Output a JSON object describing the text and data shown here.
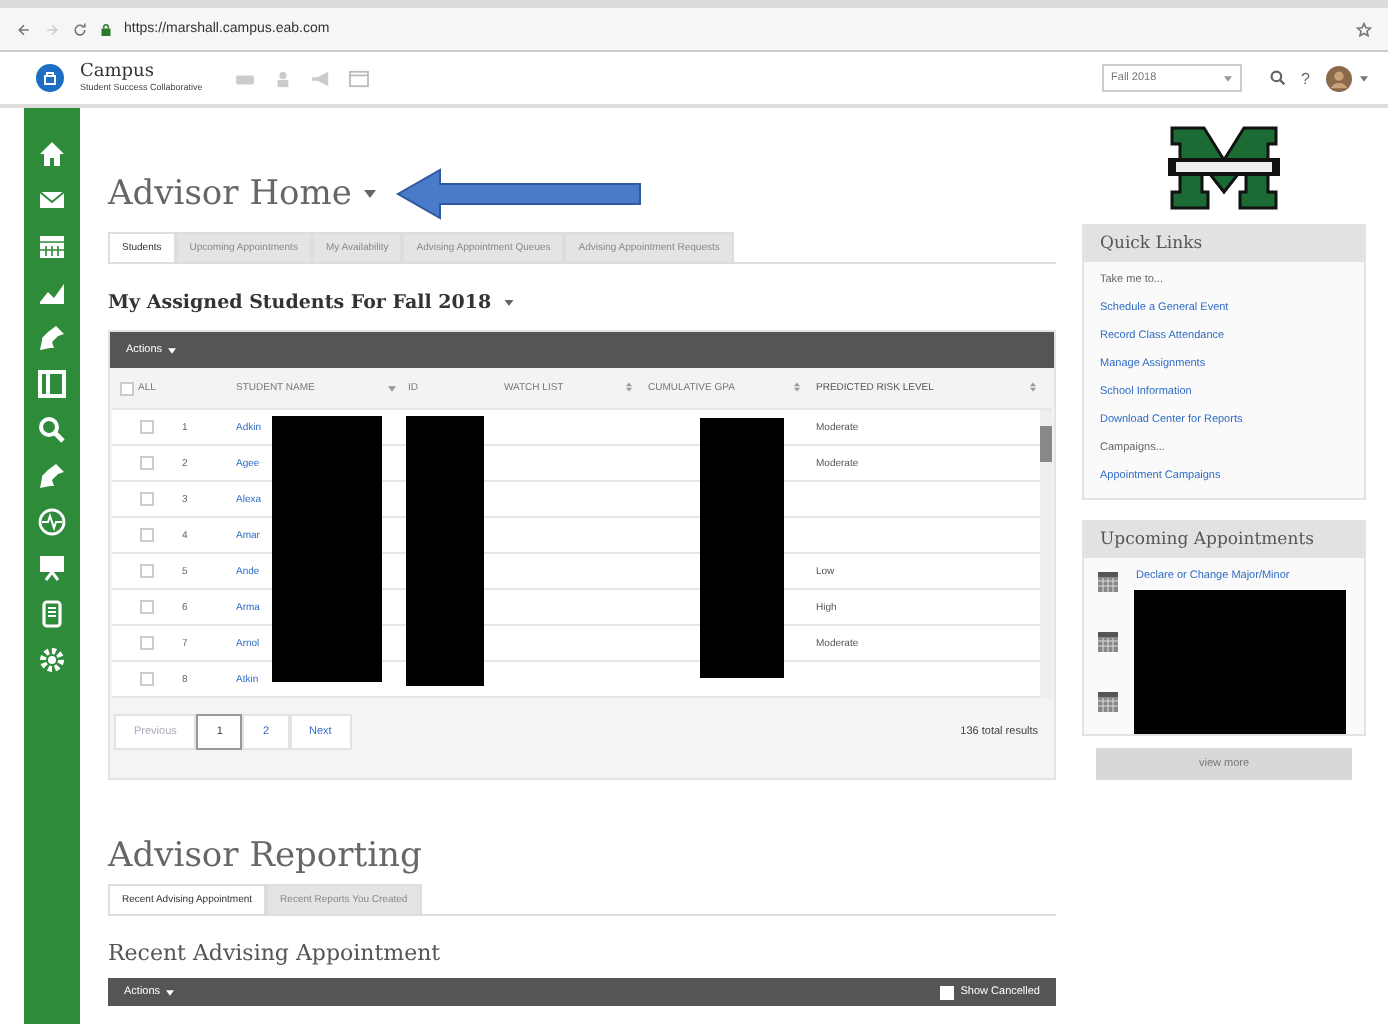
{
  "browser": {
    "url": "https://marshall.campus.eab.com"
  },
  "app_header": {
    "brand": "Campus",
    "tagline": "Student Success Collaborative",
    "term": "Fall 2018",
    "help": "?"
  },
  "page_title": "Advisor Home",
  "tabs": [
    {
      "label": "Students",
      "selected": true
    },
    {
      "label": "Upcoming Appointments",
      "selected": false
    },
    {
      "label": "My Availability",
      "selected": false
    },
    {
      "label": "Advising Appointment Queues",
      "selected": false
    },
    {
      "label": "Advising Appointment Requests",
      "selected": false
    }
  ],
  "section_title": "My Assigned Students For Fall 2018",
  "table": {
    "actions": "Actions",
    "all_checked": false,
    "columns": [
      "ALL",
      "STUDENT NAME",
      "ID",
      "WATCH LIST",
      "CUMULATIVE GPA",
      "PREDICTED RISK LEVEL"
    ],
    "rows": [
      {
        "number": "1",
        "name": "Adkin",
        "risk": "Moderate",
        "checked": false
      },
      {
        "number": "2",
        "name": "Agee",
        "risk": "Moderate",
        "checked": false
      },
      {
        "number": "3",
        "name": "Alexa",
        "checked": false
      },
      {
        "number": "4",
        "name": "Amar",
        "checked": false
      },
      {
        "number": "5",
        "name": "Ande",
        "risk": "Low",
        "checked": false
      },
      {
        "number": "6",
        "name": "Arma",
        "risk": "High",
        "checked": false
      },
      {
        "number": "7",
        "name": "Arnol",
        "risk": "Moderate",
        "checked": false
      },
      {
        "number": "8",
        "name": "Atkin",
        "checked": false
      }
    ]
  },
  "pagination": {
    "pages": [
      {
        "label": "Previous",
        "selected": false,
        "disabled": true
      },
      {
        "label": "1",
        "selected": true,
        "disabled": false
      },
      {
        "label": "2",
        "selected": false,
        "disabled": false
      },
      {
        "label": "Next",
        "selected": false,
        "disabled": false
      }
    ],
    "total": "136 total results"
  },
  "quick_links": {
    "title": "Quick Links",
    "items": [
      {
        "kind": "heading",
        "text": "Take me to..."
      },
      {
        "kind": "link",
        "text": "Schedule a General Event"
      },
      {
        "kind": "link",
        "text": "Record Class Attendance"
      },
      {
        "kind": "link",
        "text": "Manage Assignments"
      },
      {
        "kind": "link",
        "text": "School Information"
      },
      {
        "kind": "link",
        "text": "Download Center for Reports"
      },
      {
        "kind": "heading",
        "text": "Campaigns..."
      },
      {
        "kind": "link",
        "text": "Appointment Campaigns"
      }
    ]
  },
  "upcoming": {
    "title": "Upcoming Appointments",
    "items": [
      {
        "kind": "titled",
        "title": "Declare or Change Major/Minor"
      },
      {
        "kind": "redacted"
      },
      {
        "kind": "redacted"
      }
    ],
    "view_more": "view more"
  },
  "reporting": {
    "title": "Advisor Reporting",
    "tabs": [
      {
        "label": "Recent Advising Appointment",
        "selected": true
      },
      {
        "label": "Recent Reports You Created",
        "selected": false
      }
    ],
    "section_title": "Recent Advising Appointment",
    "actions": "Actions",
    "show_cancelled": {
      "label": "Show Cancelled",
      "checked": false
    }
  }
}
